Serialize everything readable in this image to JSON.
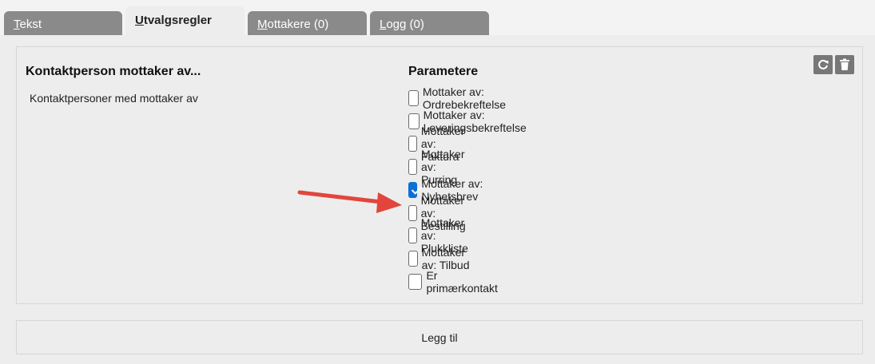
{
  "tabs": [
    {
      "first": "T",
      "rest": "ekst",
      "active": false
    },
    {
      "first": "U",
      "rest": "tvalgsregler",
      "active": true
    },
    {
      "first": "M",
      "rest": "ottakere (0)",
      "active": false
    },
    {
      "first": "L",
      "rest": "ogg (0)",
      "active": false
    }
  ],
  "rule": {
    "title": "Kontaktperson mottaker av...",
    "description": "Kontaktpersoner med mottaker av"
  },
  "parameters": {
    "title": "Parametere",
    "items": [
      {
        "label": "Mottaker av: Ordrebekreftelse",
        "checked": false
      },
      {
        "label": "Mottaker av: Leveringsbekreftelse",
        "checked": false
      },
      {
        "label": "Mottaker av: Faktura",
        "checked": false
      },
      {
        "label": "Mottaker av: Purring",
        "checked": false
      },
      {
        "label": "Mottaker av: Nyhetsbrev",
        "checked": true
      },
      {
        "label": "Mottaker av: Bestilling",
        "checked": false
      },
      {
        "label": "Mottaker av: Plukkliste",
        "checked": false
      },
      {
        "label": "Mottaker av: Tilbud",
        "checked": false
      },
      {
        "label": "Er primærkontakt",
        "checked": false
      }
    ]
  },
  "actions": {
    "refresh_icon": "refresh-icon",
    "delete_icon": "trash-icon",
    "add_label": "Legg til"
  },
  "annotation": {
    "arrow_color": "#e2453c"
  }
}
